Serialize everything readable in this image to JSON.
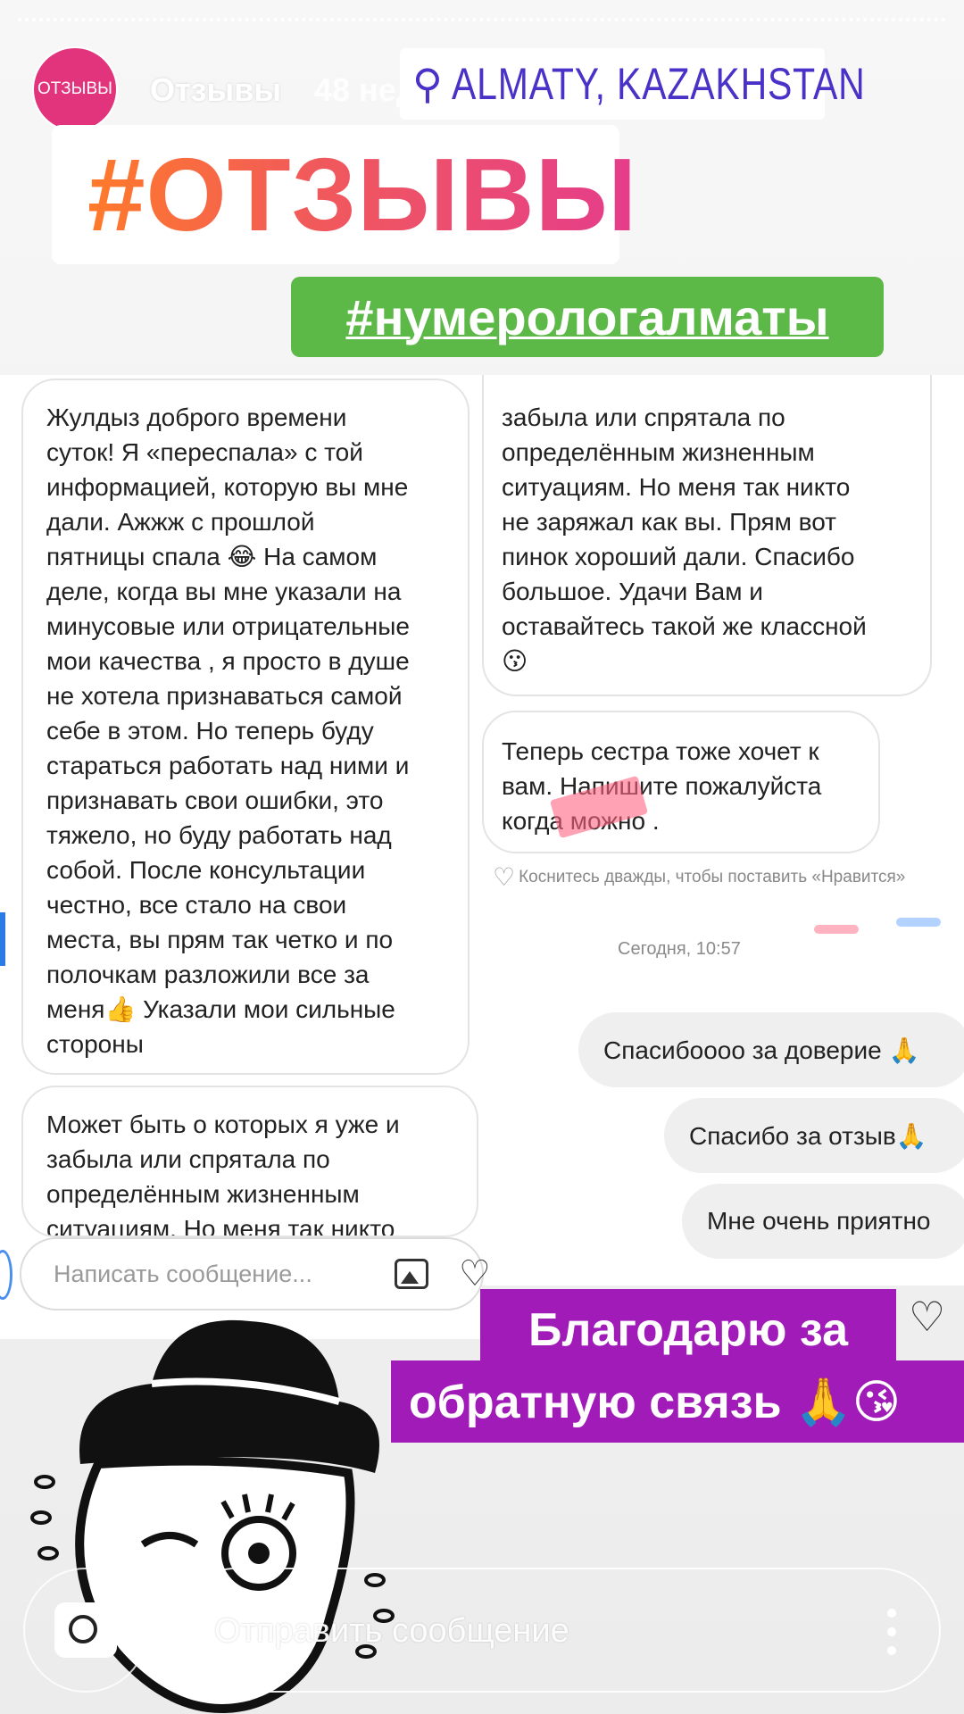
{
  "header": {
    "avatar_text": "ОТЗЫВЫ",
    "account_name": "Отзывы",
    "time_ago": "48 нед.",
    "location": "ALMATY, KAZAKHSTAN"
  },
  "stickers": {
    "hashtag_main": "#ОТЗЫВЫ",
    "hashtag_secondary": "#нумерологалматы",
    "caption_line1": "Благодарю за",
    "caption_line2": "обратную связь 🙏😘"
  },
  "chat": {
    "incoming": [
      "Жулдыз доброго времени\nсуток! Я «переспала» с той\nинформацией, которую вы мне\nдали. Ажжж с прошлой\nпятницы спала 😂 На самом\nделе, когда вы мне указали на\nминусовые или отрицательные\nмои качества , я просто в душе\nне хотела признаваться самой\nсебе в этом. Но теперь буду\nстараться работать над ними и\nпризнавать свои ошибки, это\nтяжело, но буду работать над\nсобой. После консультации\nчестно, все стало на свои\nместа, вы прям так четко и по\nполочкам разложили все за\nменя👍 Указали мои сильные\nстороны",
      "Может быть о которых я уже и\nзабыла или спрятала по\nопределённым жизненным\nситуациям. Но меня так никто",
      "забыла или спрятала по\nопределённым жизненным\nситуациям. Но меня так никто\nне заряжал как вы. Прям вот\nпинок хороший дали. Спасибо\nбольшое. Удачи Вам и\nоставайтесь такой же классной\n😗",
      "Теперь сестра тоже хочет к\nвам. Напишите пожалуйста\nкогда можно ."
    ],
    "like_hint": "Коснитесь дважды, чтобы поставить «Нравится»",
    "timestamp": "Сегодня, 10:57",
    "outgoing": [
      "Спасибоооо за доверие 🙏",
      "Спасибо за отзыв🙏",
      "Мне очень приятно"
    ],
    "composer_placeholder": "Написать сообщение..."
  },
  "footer": {
    "send_placeholder": "Отправить сообщение"
  },
  "icons": [
    "camera-icon",
    "more-icon",
    "heart-icon",
    "image-icon",
    "location-pin-icon"
  ],
  "colors": {
    "avatar": "#e2347c",
    "location": "#4a32c8",
    "hashtag_green": "#5cb947",
    "caption_purple": "#a01bb8"
  }
}
